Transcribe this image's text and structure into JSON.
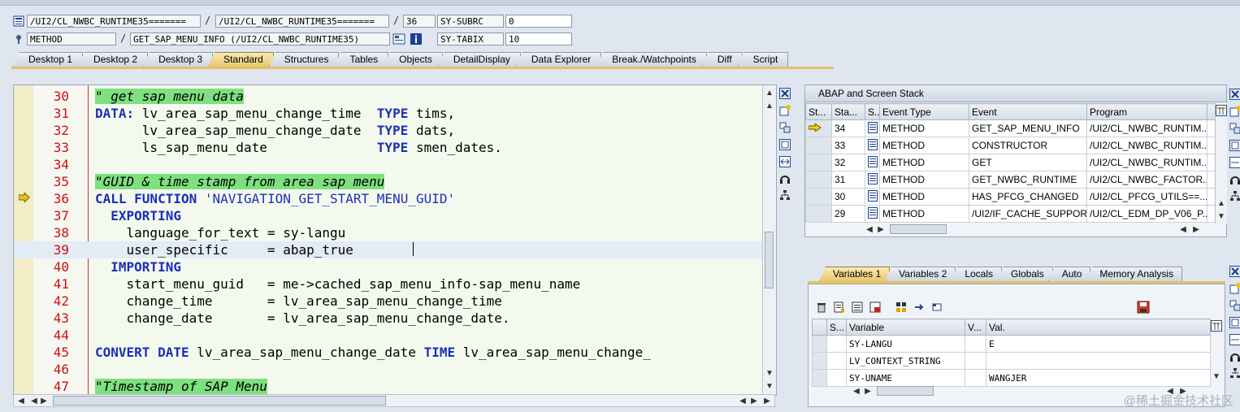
{
  "header": {
    "row1": {
      "field1": "/UI2/CL_NWBC_RUNTIME35=======",
      "sep1": "/",
      "field2": "/UI2/CL_NWBC_RUNTIME35=======",
      "sep2": "/",
      "field3": "36",
      "sysvar_name": "SY-SUBRC",
      "sysvar_value": "0"
    },
    "row2": {
      "field1": "METHOD",
      "sep1": "/",
      "field2": "GET_SAP_MENU_INFO (/UI2/CL_NWBC_RUNTIME35)",
      "sysvar_name": "SY-TABIX",
      "sysvar_value": "10"
    }
  },
  "tabs": [
    "Desktop 1",
    "Desktop 2",
    "Desktop 3",
    "Standard",
    "Structures",
    "Tables",
    "Objects",
    "DetailDisplay",
    "Data Explorer",
    "Break./Watchpoints",
    "Diff",
    "Script"
  ],
  "active_tab": "Standard",
  "editor": {
    "lines": [
      {
        "n": "30",
        "parts": [
          [
            "cmt",
            "\" get sap menu data"
          ]
        ]
      },
      {
        "n": "31",
        "parts": [
          [
            "kw",
            "DATA:"
          ],
          [
            "",
            " lv_area_sap_menu_change_time  "
          ],
          [
            "kw",
            "TYPE"
          ],
          [
            "",
            " tims,"
          ]
        ]
      },
      {
        "n": "32",
        "parts": [
          [
            "",
            "      lv_area_sap_menu_change_date  "
          ],
          [
            "kw",
            "TYPE"
          ],
          [
            "",
            " dats,"
          ]
        ]
      },
      {
        "n": "33",
        "parts": [
          [
            "",
            "      ls_sap_menu_date              "
          ],
          [
            "kw",
            "TYPE"
          ],
          [
            "",
            " smen_dates."
          ]
        ]
      },
      {
        "n": "34",
        "parts": []
      },
      {
        "n": "35",
        "parts": [
          [
            "cmt",
            "\"GUID & time stamp from area sap menu"
          ]
        ]
      },
      {
        "n": "36",
        "parts": [
          [
            "kw",
            "CALL FUNCTION"
          ],
          [
            "",
            " "
          ],
          [
            "str",
            "'NAVIGATION_GET_START_MENU_GUID'"
          ]
        ]
      },
      {
        "n": "37",
        "parts": [
          [
            "kw",
            "  EXPORTING"
          ]
        ]
      },
      {
        "n": "38",
        "parts": [
          [
            "",
            "    language_for_text = sy-langu"
          ]
        ]
      },
      {
        "n": "39",
        "parts": [
          [
            "",
            "    user_specific     = abap_true"
          ]
        ]
      },
      {
        "n": "40",
        "parts": [
          [
            "kw",
            "  IMPORTING"
          ]
        ]
      },
      {
        "n": "41",
        "parts": [
          [
            "",
            "    start_menu_guid   = me->cached_sap_menu_info-sap_menu_name"
          ]
        ]
      },
      {
        "n": "42",
        "parts": [
          [
            "",
            "    change_time       = lv_area_sap_menu_change_time"
          ]
        ]
      },
      {
        "n": "43",
        "parts": [
          [
            "",
            "    change_date       = lv_area_sap_menu_change_date."
          ]
        ]
      },
      {
        "n": "44",
        "parts": []
      },
      {
        "n": "45",
        "parts": [
          [
            "kw",
            "CONVERT DATE"
          ],
          [
            "",
            " lv_area_sap_menu_change_date "
          ],
          [
            "kw",
            "TIME"
          ],
          [
            "",
            " lv_area_sap_menu_change_"
          ]
        ]
      },
      {
        "n": "46",
        "parts": []
      },
      {
        "n": "47",
        "parts": [
          [
            "cmt",
            "\"Timestamp of SAP Menu"
          ]
        ]
      }
    ]
  },
  "stack": {
    "title": "ABAP and Screen Stack",
    "columns": [
      "St...",
      "Sta...",
      "S...",
      "Event Type",
      "Event",
      "Program"
    ],
    "rows": [
      {
        "level": "34",
        "type": "METHOD",
        "event": "GET_SAP_MENU_INFO",
        "program": "/UI2/CL_NWBC_RUNTIM..."
      },
      {
        "level": "33",
        "type": "METHOD",
        "event": "CONSTRUCTOR",
        "program": "/UI2/CL_NWBC_RUNTIM..."
      },
      {
        "level": "32",
        "type": "METHOD",
        "event": "GET",
        "program": "/UI2/CL_NWBC_RUNTIM..."
      },
      {
        "level": "31",
        "type": "METHOD",
        "event": "GET_NWBC_RUNTIME",
        "program": "/UI2/CL_NWBC_FACTOR..."
      },
      {
        "level": "30",
        "type": "METHOD",
        "event": "HAS_PFCG_CHANGED",
        "program": "/UI2/CL_PFCG_UTILS==..."
      },
      {
        "level": "29",
        "type": "METHOD",
        "event": "/UI2/IF_CACHE_SUPPOR...",
        "program": "/UI2/CL_EDM_DP_V06_P..."
      }
    ]
  },
  "vartabs": [
    "Variables 1",
    "Variables 2",
    "Locals",
    "Globals",
    "Auto",
    "Memory Analysis"
  ],
  "active_vartab": "Variables 1",
  "variables": {
    "columns": [
      "S...",
      "Variable",
      "V...",
      "Val."
    ],
    "rows": [
      {
        "name": "SY-LANGU",
        "value": "E"
      },
      {
        "name": "LV_CONTEXT_STRING",
        "value": ""
      },
      {
        "name": "SY-UNAME",
        "value": "WANGJER"
      }
    ]
  },
  "watermark": "@稀土掘金技术社区"
}
